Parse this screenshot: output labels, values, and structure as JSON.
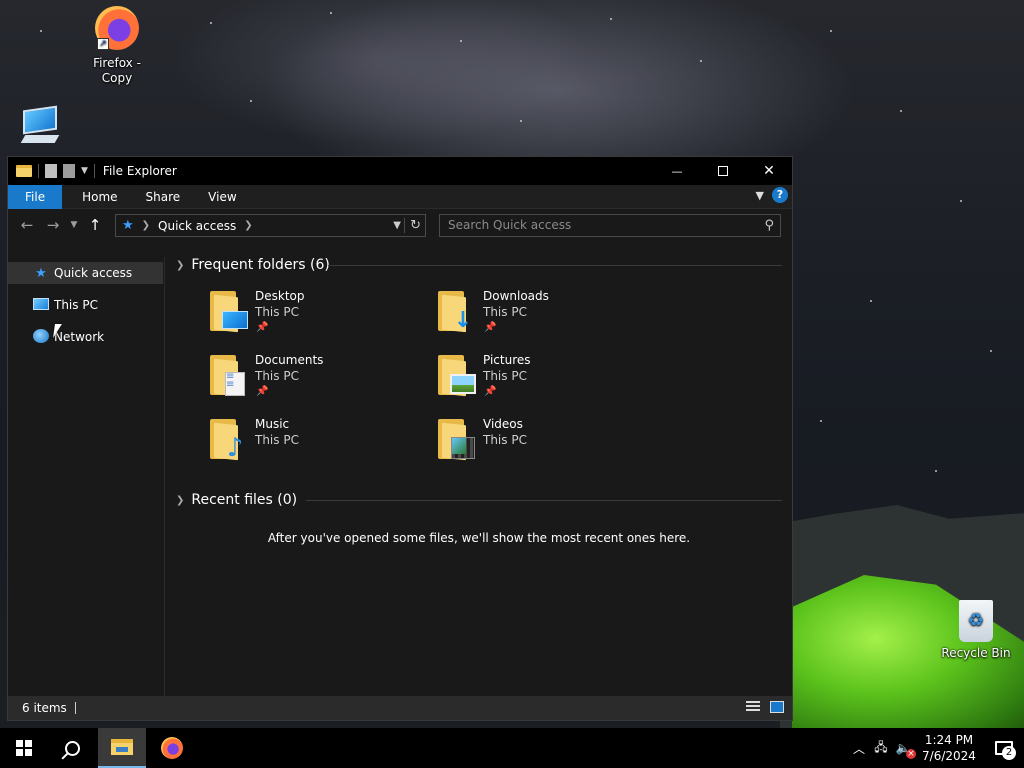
{
  "desktop": {
    "icons": [
      {
        "label": "Firefox - Copy",
        "icon": "firefox-icon"
      },
      {
        "label": "",
        "icon": "this-pc-icon"
      },
      {
        "label": "Recycle Bin",
        "icon": "recycle-bin-icon"
      }
    ]
  },
  "window": {
    "title": "File Explorer",
    "controls": {
      "minimize": "—",
      "maximize": "",
      "close": "✕"
    },
    "ribbon_tabs": [
      "File",
      "Home",
      "Share",
      "View"
    ],
    "help": "?",
    "address": {
      "location": "Quick access"
    },
    "search": {
      "placeholder": "Search Quick access"
    },
    "nav_pane": [
      {
        "label": "Quick access",
        "icon": "star-icon",
        "selected": true
      },
      {
        "label": "This PC",
        "icon": "this-pc-icon",
        "selected": false
      },
      {
        "label": "Network",
        "icon": "network-icon",
        "selected": false
      }
    ],
    "frequent_folders": {
      "header": "Frequent folders (6)",
      "items": [
        {
          "name": "Desktop",
          "location": "This PC",
          "pinned": true,
          "icon": "desktop-folder-icon"
        },
        {
          "name": "Downloads",
          "location": "This PC",
          "pinned": true,
          "icon": "downloads-folder-icon"
        },
        {
          "name": "Documents",
          "location": "This PC",
          "pinned": true,
          "icon": "documents-folder-icon"
        },
        {
          "name": "Pictures",
          "location": "This PC",
          "pinned": true,
          "icon": "pictures-folder-icon"
        },
        {
          "name": "Music",
          "location": "This PC",
          "pinned": false,
          "icon": "music-folder-icon"
        },
        {
          "name": "Videos",
          "location": "This PC",
          "pinned": false,
          "icon": "videos-folder-icon"
        }
      ]
    },
    "recent_files": {
      "header": "Recent files (0)",
      "empty_message": "After you've opened some files, we'll show the most recent ones here."
    },
    "status": {
      "item_count": "6 items"
    }
  },
  "taskbar": {
    "clock": {
      "time": "1:24 PM",
      "date": "7/6/2024"
    },
    "notification_count": "2",
    "colors": {
      "accent": "#1979ca",
      "active_indicator": "#76b9ed"
    }
  }
}
